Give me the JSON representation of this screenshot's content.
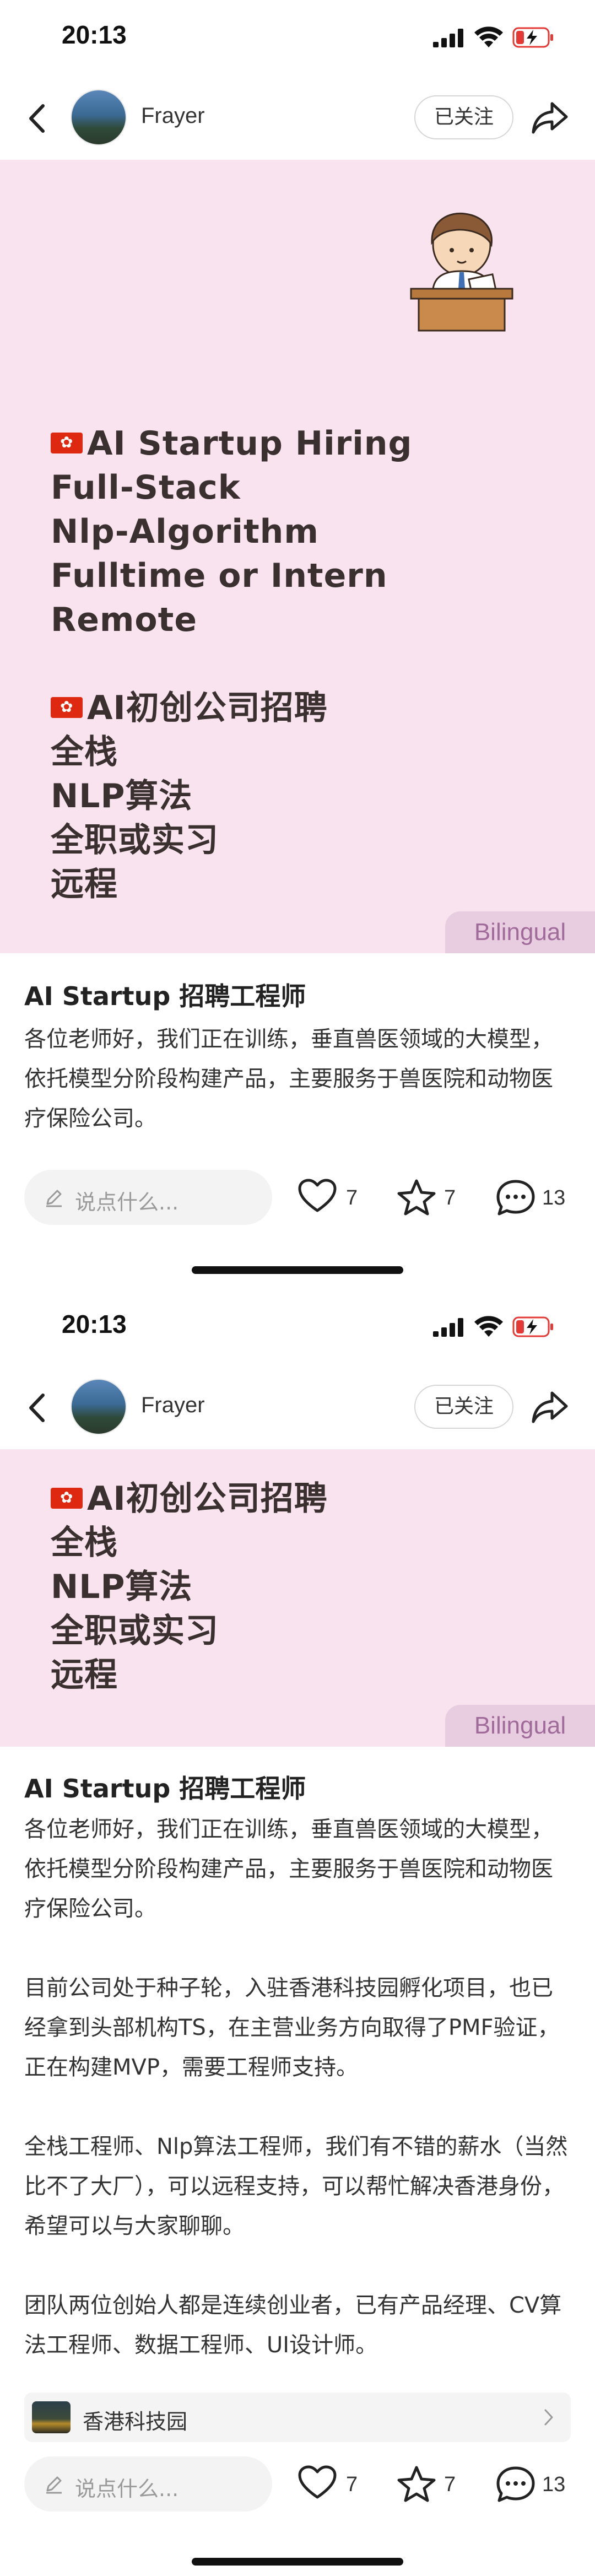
{
  "status_bar": {
    "time": "20:13"
  },
  "nav": {
    "author": "Frayer",
    "follow_label": "已关注"
  },
  "card": {
    "english_lines": [
      "AI Startup Hiring",
      "Full-Stack",
      "Nlp-Algorithm",
      "Fulltime  or  Intern",
      "Remote"
    ],
    "chinese_lines": [
      "AI初创公司招聘",
      "全栈",
      "NLP算法",
      "全职或实习",
      "远程"
    ],
    "tag": "Bilingual"
  },
  "post": {
    "title": "AI Startup 招聘工程师",
    "paragraphs": [
      "各位老师好，我们正在训练，垂直兽医领域的大模型，依托模型分阶段构建产品，主要服务于兽医院和动物医疗保险公司。",
      "目前公司处于种子轮，入驻香港科技园孵化项目，也已经拿到头部机构TS，在主营业务方向取得了PMF验证，正在构建MVP，需要工程师支持。",
      "全栈工程师、Nlp算法工程师，我们有不错的薪水（当然比不了大厂），可以远程支持，可以帮忙解决香港身份，希望可以与大家聊聊。",
      "团队两位创始人都是连续创业者，已有产品经理、CV算法工程师、数据工程师、UI设计师。"
    ],
    "location": "香港科技园"
  },
  "actions": {
    "comment_placeholder": "说点什么...",
    "likes": "7",
    "collects": "7",
    "comments": "13"
  },
  "colors": {
    "card_background": "#f9e3ee",
    "tag_background": "#e8cde0",
    "tag_text": "#a06a9a",
    "battery_charging": "#e53935"
  }
}
